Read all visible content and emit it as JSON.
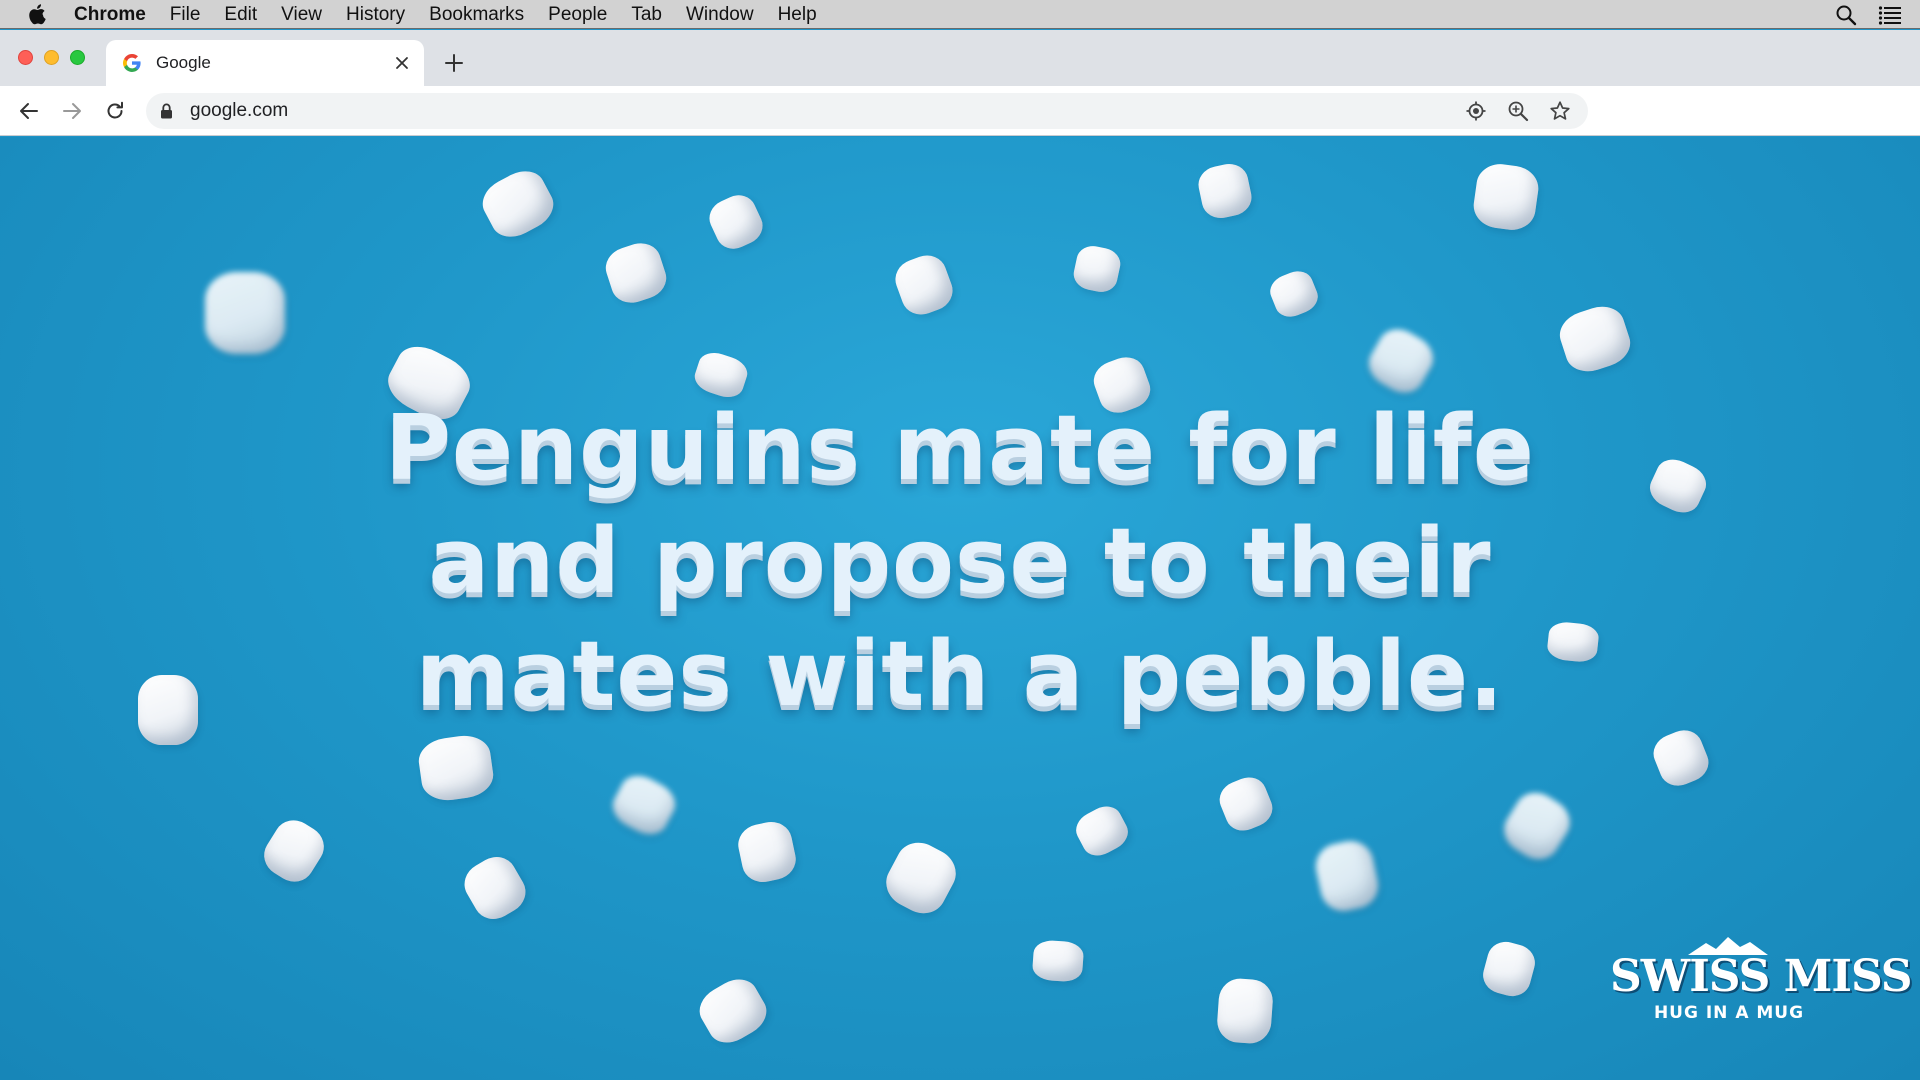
{
  "menubar": {
    "app_name": "Chrome",
    "items": [
      "File",
      "Edit",
      "View",
      "History",
      "Bookmarks",
      "People",
      "Tab",
      "Window",
      "Help"
    ],
    "icons": [
      "apple-icon",
      "spotlight-search-icon",
      "control-center-list-icon"
    ]
  },
  "browser": {
    "tab": {
      "title": "Google",
      "favicon": "google-g-icon"
    },
    "url": "google.com",
    "icons": [
      "back-arrow-icon",
      "forward-arrow-icon",
      "reload-icon",
      "lock-icon",
      "location-target-icon",
      "zoom-in-icon",
      "bookmark-star-icon",
      "close-icon",
      "plus-icon"
    ]
  },
  "content": {
    "headline_lines": [
      "Penguins mate for life",
      "and propose to their",
      "mates with a pebble."
    ],
    "brand": {
      "name": "SWISS MISS",
      "tagline": "HUG IN A MUG"
    },
    "colors": {
      "background": "#1e93c6",
      "text": "#e4f1fb"
    }
  }
}
